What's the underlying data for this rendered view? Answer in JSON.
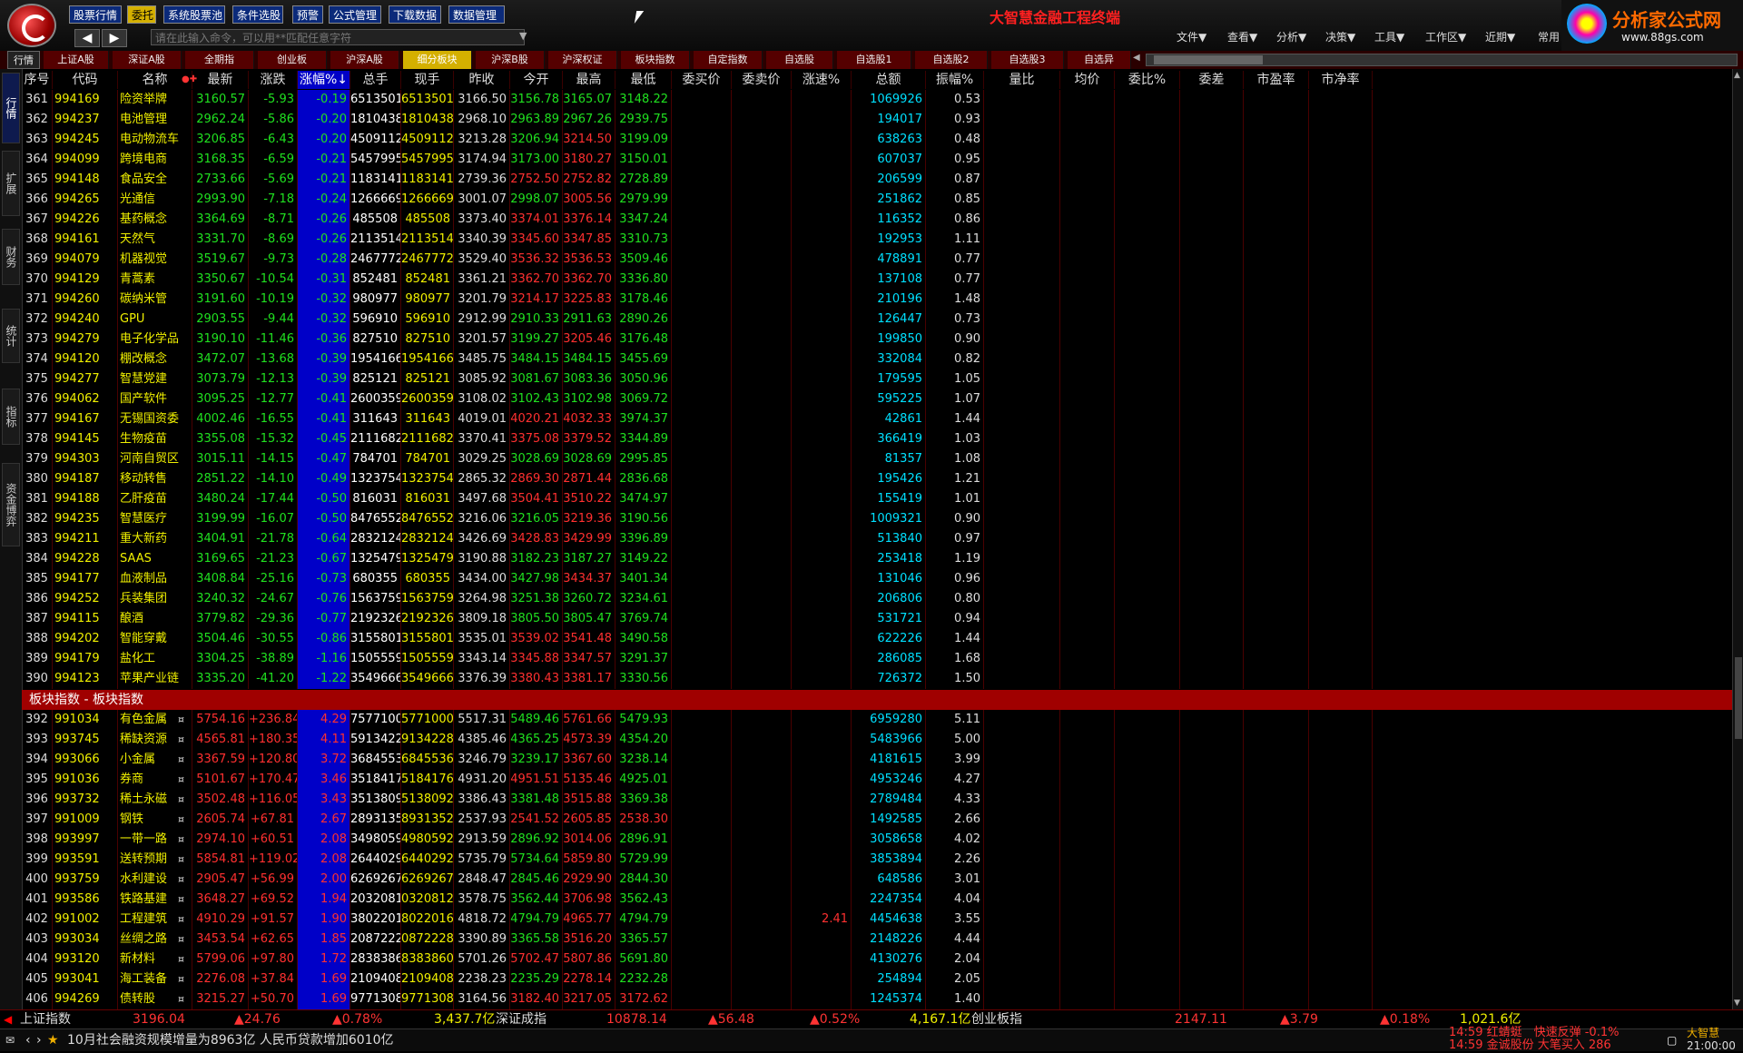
{
  "toolbar": {
    "buttons": [
      "股票行情",
      "委托",
      "系统股票池",
      "条件选股",
      "预警",
      "公式管理",
      "下载数据",
      "数据管理"
    ],
    "active": "委托",
    "cmd_placeholder": "请在此输入命令，可以用**匹配任意字符"
  },
  "app_title": "大智慧金融工程终端",
  "menus": [
    "文件▼",
    "查看▼",
    "分析▼",
    "决策▼",
    "工具▼",
    "工作区▼",
    "近期▼",
    "常用"
  ],
  "brand": {
    "name": "分析家公式网",
    "url": "www.88gs.com"
  },
  "tabs": [
    "行情",
    "上证A股",
    "深证A股",
    "全期指",
    "创业板",
    "沪深A股",
    "细分板块",
    "沪深B股",
    "沪深权证",
    "板块指数",
    "自定指数",
    "自选股",
    "自选股1",
    "自选股2",
    "自选股3",
    "自选异"
  ],
  "active_tab": "细分板块",
  "sidebar": [
    "行情",
    "扩展",
    "财务",
    "统计",
    "指标",
    "资金博弈"
  ],
  "columns": [
    "序号",
    "代码",
    "名称",
    "最新",
    "涨跌",
    "涨幅%↓",
    "总手",
    "现手",
    "昨收",
    "今开",
    "最高",
    "最低",
    "委买价",
    "委卖价",
    "涨速%",
    "总额",
    "振幅%",
    "量比",
    "均价",
    "委比%",
    "委差",
    "市盈率",
    "市净率"
  ],
  "rows": [
    [
      "361",
      "994169",
      "险资举牌",
      "",
      "3160.57",
      "-5.93",
      "-0.19",
      "6513501",
      "6513501",
      "3166.50",
      "3156.78",
      "3165.07",
      "3148.22",
      "",
      "",
      "",
      "1069926",
      "0.53"
    ],
    [
      "362",
      "994237",
      "电池管理",
      "",
      "2962.24",
      "-5.86",
      "-0.20",
      "1810438",
      "1810438",
      "2968.10",
      "2963.89",
      "2967.26",
      "2939.75",
      "",
      "",
      "",
      "194017",
      "0.93"
    ],
    [
      "363",
      "994245",
      "电动物流车",
      "",
      "3206.85",
      "-6.43",
      "-0.20",
      "4509112",
      "4509112",
      "3213.28",
      "3206.94",
      "3214.50",
      "3199.09",
      "",
      "",
      "",
      "638263",
      "0.48"
    ],
    [
      "364",
      "994099",
      "跨境电商",
      "",
      "3168.35",
      "-6.59",
      "-0.21",
      "5457995",
      "5457995",
      "3174.94",
      "3173.00",
      "3180.27",
      "3150.01",
      "",
      "",
      "",
      "607037",
      "0.95"
    ],
    [
      "365",
      "994148",
      "食品安全",
      "",
      "2733.66",
      "-5.69",
      "-0.21",
      "1183141",
      "1183141",
      "2739.36",
      "2752.50",
      "2752.82",
      "2728.89",
      "",
      "",
      "",
      "206599",
      "0.87"
    ],
    [
      "366",
      "994265",
      "光通信",
      "",
      "2993.90",
      "-7.18",
      "-0.24",
      "1266669",
      "1266669",
      "3001.07",
      "2998.07",
      "3005.56",
      "2979.99",
      "",
      "",
      "",
      "251862",
      "0.85"
    ],
    [
      "367",
      "994226",
      "基药概念",
      "",
      "3364.69",
      "-8.71",
      "-0.26",
      "485508",
      "485508",
      "3373.40",
      "3374.01",
      "3376.14",
      "3347.24",
      "",
      "",
      "",
      "116352",
      "0.86"
    ],
    [
      "368",
      "994161",
      "天然气",
      "",
      "3331.70",
      "-8.69",
      "-0.26",
      "2113514",
      "2113514",
      "3340.39",
      "3345.60",
      "3347.85",
      "3310.73",
      "",
      "",
      "",
      "192953",
      "1.11"
    ],
    [
      "369",
      "994079",
      "机器视觉",
      "",
      "3519.67",
      "-9.73",
      "-0.28",
      "2467772",
      "2467772",
      "3529.40",
      "3536.32",
      "3536.53",
      "3509.46",
      "",
      "",
      "",
      "478891",
      "0.77"
    ],
    [
      "370",
      "994129",
      "青蒿素",
      "",
      "3350.67",
      "-10.54",
      "-0.31",
      "852481",
      "852481",
      "3361.21",
      "3362.70",
      "3362.70",
      "3336.80",
      "",
      "",
      "",
      "137108",
      "0.77"
    ],
    [
      "371",
      "994260",
      "碳纳米管",
      "",
      "3191.60",
      "-10.19",
      "-0.32",
      "980977",
      "980977",
      "3201.79",
      "3214.17",
      "3225.83",
      "3178.46",
      "",
      "",
      "",
      "210196",
      "1.48"
    ],
    [
      "372",
      "994240",
      "GPU",
      "",
      "2903.55",
      "-9.44",
      "-0.32",
      "596910",
      "596910",
      "2912.99",
      "2910.33",
      "2911.63",
      "2890.26",
      "",
      "",
      "",
      "126447",
      "0.73"
    ],
    [
      "373",
      "994279",
      "电子化学品",
      "",
      "3190.10",
      "-11.46",
      "-0.36",
      "827510",
      "827510",
      "3201.57",
      "3199.27",
      "3205.46",
      "3176.48",
      "",
      "",
      "",
      "199850",
      "0.90"
    ],
    [
      "374",
      "994120",
      "棚改概念",
      "",
      "3472.07",
      "-13.68",
      "-0.39",
      "1954166",
      "1954166",
      "3485.75",
      "3484.15",
      "3484.15",
      "3455.69",
      "",
      "",
      "",
      "332084",
      "0.82"
    ],
    [
      "375",
      "994277",
      "智慧党建",
      "",
      "3073.79",
      "-12.13",
      "-0.39",
      "825121",
      "825121",
      "3085.92",
      "3081.67",
      "3083.36",
      "3050.96",
      "",
      "",
      "",
      "179595",
      "1.05"
    ],
    [
      "376",
      "994062",
      "国产软件",
      "",
      "3095.25",
      "-12.77",
      "-0.41",
      "2600359",
      "2600359",
      "3108.02",
      "3102.43",
      "3102.98",
      "3069.72",
      "",
      "",
      "",
      "595225",
      "1.07"
    ],
    [
      "377",
      "994167",
      "无锡国资委",
      "",
      "4002.46",
      "-16.55",
      "-0.41",
      "311643",
      "311643",
      "4019.01",
      "4020.21",
      "4032.33",
      "3974.37",
      "",
      "",
      "",
      "42861",
      "1.44"
    ],
    [
      "378",
      "994145",
      "生物疫苗",
      "",
      "3355.08",
      "-15.32",
      "-0.45",
      "2111682",
      "2111682",
      "3370.41",
      "3375.08",
      "3379.52",
      "3344.89",
      "",
      "",
      "",
      "366419",
      "1.03"
    ],
    [
      "379",
      "994303",
      "河南自贸区",
      "",
      "3015.11",
      "-14.15",
      "-0.47",
      "784701",
      "784701",
      "3029.25",
      "3028.69",
      "3028.69",
      "2995.85",
      "",
      "",
      "",
      "81357",
      "1.08"
    ],
    [
      "380",
      "994187",
      "移动转售",
      "",
      "2851.22",
      "-14.10",
      "-0.49",
      "1323754",
      "1323754",
      "2865.32",
      "2869.30",
      "2871.44",
      "2836.68",
      "",
      "",
      "",
      "195426",
      "1.21"
    ],
    [
      "381",
      "994188",
      "乙肝疫苗",
      "",
      "3480.24",
      "-17.44",
      "-0.50",
      "816031",
      "816031",
      "3497.68",
      "3504.41",
      "3510.22",
      "3474.97",
      "",
      "",
      "",
      "155419",
      "1.01"
    ],
    [
      "382",
      "994235",
      "智慧医疗",
      "",
      "3199.99",
      "-16.07",
      "-0.50",
      "8476552",
      "8476552",
      "3216.06",
      "3216.05",
      "3219.36",
      "3190.56",
      "",
      "",
      "",
      "1009321",
      "0.90"
    ],
    [
      "383",
      "994211",
      "重大新药",
      "",
      "3404.91",
      "-21.78",
      "-0.64",
      "2832124",
      "2832124",
      "3426.69",
      "3428.83",
      "3429.99",
      "3396.89",
      "",
      "",
      "",
      "513840",
      "0.97"
    ],
    [
      "384",
      "994228",
      "SAAS",
      "",
      "3169.65",
      "-21.23",
      "-0.67",
      "1325479",
      "1325479",
      "3190.88",
      "3182.23",
      "3187.27",
      "3149.22",
      "",
      "",
      "",
      "253418",
      "1.19"
    ],
    [
      "385",
      "994177",
      "血液制品",
      "",
      "3408.84",
      "-25.16",
      "-0.73",
      "680355",
      "680355",
      "3434.00",
      "3427.98",
      "3434.37",
      "3401.34",
      "",
      "",
      "",
      "131046",
      "0.96"
    ],
    [
      "386",
      "994252",
      "兵装集团",
      "",
      "3240.32",
      "-24.67",
      "-0.76",
      "1563759",
      "1563759",
      "3264.98",
      "3251.38",
      "3260.72",
      "3234.61",
      "",
      "",
      "",
      "206806",
      "0.80"
    ],
    [
      "387",
      "994115",
      "酿酒",
      "",
      "3779.82",
      "-29.36",
      "-0.77",
      "2192326",
      "2192326",
      "3809.18",
      "3805.50",
      "3805.47",
      "3769.74",
      "",
      "",
      "",
      "531721",
      "0.94"
    ],
    [
      "388",
      "994202",
      "智能穿戴",
      "",
      "3504.46",
      "-30.55",
      "-0.86",
      "3155801",
      "3155801",
      "3535.01",
      "3539.02",
      "3541.48",
      "3490.58",
      "",
      "",
      "",
      "622226",
      "1.44"
    ],
    [
      "389",
      "994179",
      "盐化工",
      "",
      "3304.25",
      "-38.89",
      "-1.16",
      "1505559",
      "1505559",
      "3343.14",
      "3345.88",
      "3347.57",
      "3291.37",
      "",
      "",
      "",
      "286085",
      "1.68"
    ],
    [
      "390",
      "994123",
      "苹果产业链",
      "",
      "3335.20",
      "-41.20",
      "-1.22",
      "3549666",
      "3549666",
      "3376.39",
      "3380.43",
      "3381.17",
      "3330.56",
      "",
      "",
      "",
      "726372",
      "1.50"
    ]
  ],
  "section_label": "板块指数 - 板块指数",
  "rows2": [
    [
      "392",
      "991034",
      "有色金属",
      "¤",
      "5754.16",
      "+236.84",
      "4.29",
      "75771000",
      "5771000",
      "5517.31",
      "5489.46",
      "5761.66",
      "5479.93",
      "",
      "",
      "",
      "6959280",
      "5.11"
    ],
    [
      "393",
      "993745",
      "稀缺资源",
      "¤",
      "4565.81",
      "+180.35",
      "4.11",
      "59134228",
      "9134228",
      "4385.46",
      "4365.25",
      "4573.39",
      "4354.20",
      "",
      "",
      "",
      "5483966",
      "5.00"
    ],
    [
      "394",
      "993066",
      "小金属",
      "¤",
      "3367.59",
      "+120.80",
      "3.72",
      "36845536",
      "6845536",
      "3246.79",
      "3239.17",
      "3367.60",
      "3238.14",
      "",
      "",
      "",
      "4181615",
      "3.99"
    ],
    [
      "395",
      "991036",
      "券商",
      "¤",
      "5101.67",
      "+170.47",
      "3.46",
      "35184176",
      "5184176",
      "4931.20",
      "4951.51",
      "5135.46",
      "4925.01",
      "",
      "",
      "",
      "4953246",
      "4.27"
    ],
    [
      "396",
      "993732",
      "稀土永磁",
      "¤",
      "3502.48",
      "+116.05",
      "3.43",
      "35138092",
      "5138092",
      "3386.43",
      "3381.48",
      "3515.88",
      "3369.38",
      "",
      "",
      "",
      "2789484",
      "4.33"
    ],
    [
      "397",
      "991009",
      "钢铁",
      "¤",
      "2605.74",
      "+67.81",
      "2.67",
      "28931352",
      "8931352",
      "2537.93",
      "2541.52",
      "2605.85",
      "2538.30",
      "",
      "",
      "",
      "1492585",
      "2.66"
    ],
    [
      "398",
      "993997",
      "一带一路",
      "¤",
      "2974.10",
      "+60.51",
      "2.08",
      "34980592",
      "4980592",
      "2913.59",
      "2896.92",
      "3014.06",
      "2896.91",
      "",
      "",
      "",
      "3058658",
      "4.02"
    ],
    [
      "399",
      "993591",
      "送转预期",
      "¤",
      "5854.81",
      "+119.02",
      "2.08",
      "26440292",
      "6440292",
      "5735.79",
      "5734.64",
      "5859.80",
      "5729.99",
      "",
      "",
      "",
      "3853894",
      "2.26"
    ],
    [
      "400",
      "993759",
      "水利建设",
      "¤",
      "2905.47",
      "+56.99",
      "2.00",
      "6269267",
      "6269267",
      "2848.47",
      "2845.46",
      "2929.90",
      "2844.30",
      "",
      "",
      "",
      "648586",
      "3.01"
    ],
    [
      "401",
      "993586",
      "铁路基建",
      "¤",
      "3648.27",
      "+69.52",
      "1.94",
      "20320812",
      "0320812",
      "3578.75",
      "3562.44",
      "3706.98",
      "3562.43",
      "",
      "",
      "",
      "2247354",
      "4.04"
    ],
    [
      "402",
      "991002",
      "工程建筑",
      "¤",
      "4910.29",
      "+91.57",
      "1.90",
      "38022016",
      "8022016",
      "4818.72",
      "4794.79",
      "4965.77",
      "4794.79",
      "",
      "",
      "2.41",
      "4454638",
      "3.55"
    ],
    [
      "403",
      "993034",
      "丝绸之路",
      "¤",
      "3453.54",
      "+62.65",
      "1.85",
      "20872228",
      "0872228",
      "3390.89",
      "3365.58",
      "3516.20",
      "3365.57",
      "",
      "",
      "",
      "2148226",
      "4.44"
    ],
    [
      "404",
      "993120",
      "新材料",
      "¤",
      "5799.06",
      "+97.80",
      "1.72",
      "28383860",
      "8383860",
      "5701.26",
      "5702.47",
      "5807.86",
      "5691.80",
      "",
      "",
      "",
      "4130276",
      "2.04"
    ],
    [
      "405",
      "993041",
      "海工装备",
      "¤",
      "2276.08",
      "+37.84",
      "1.69",
      "2109408",
      "2109408",
      "2238.23",
      "2235.29",
      "2278.14",
      "2232.28",
      "",
      "",
      "",
      "254894",
      "2.05"
    ],
    [
      "406",
      "994269",
      "债转股",
      "¤",
      "3215.27",
      "+50.70",
      "1.69",
      "9771308",
      "9771308",
      "3164.56",
      "3182.40",
      "3217.05",
      "3172.62",
      "",
      "",
      "",
      "1245374",
      "1.40"
    ]
  ],
  "statusbar": {
    "sh_label": "上证指数",
    "sh_val": "3196.04",
    "sh_chg": "▲24.76",
    "sh_pct": "▲0.78%",
    "sh_amt": "3,437.7亿",
    "sz_label": "深证成指",
    "sz_val": "10878.14",
    "sz_chg": "▲56.48",
    "sz_pct": "▲0.52%",
    "sz_amt": "4,167.1亿",
    "cy_label": "创业板指",
    "cy_val": "2147.11",
    "cy_chg": "▲3.79",
    "cy_pct": "▲0.18%",
    "cy_amt": "1,021.6亿"
  },
  "ticker": {
    "news": "10月社会融资规模增量为8963亿 人民币贷款增加6010亿",
    "alert1": "14:59 红蜻蜓　快速反弹 -0.1%",
    "alert2": "14:59 金诚股份 大笔买入 286",
    "clock": "21:00:00",
    "brand": "大智慧"
  },
  "colors": {
    "up": "#ff3030",
    "down": "#20e020",
    "flat": "#e0e0e0",
    "code": "#f0f000",
    "name": "#f0f000",
    "sorted": "#0000c8",
    "vol": "#f0f000"
  }
}
